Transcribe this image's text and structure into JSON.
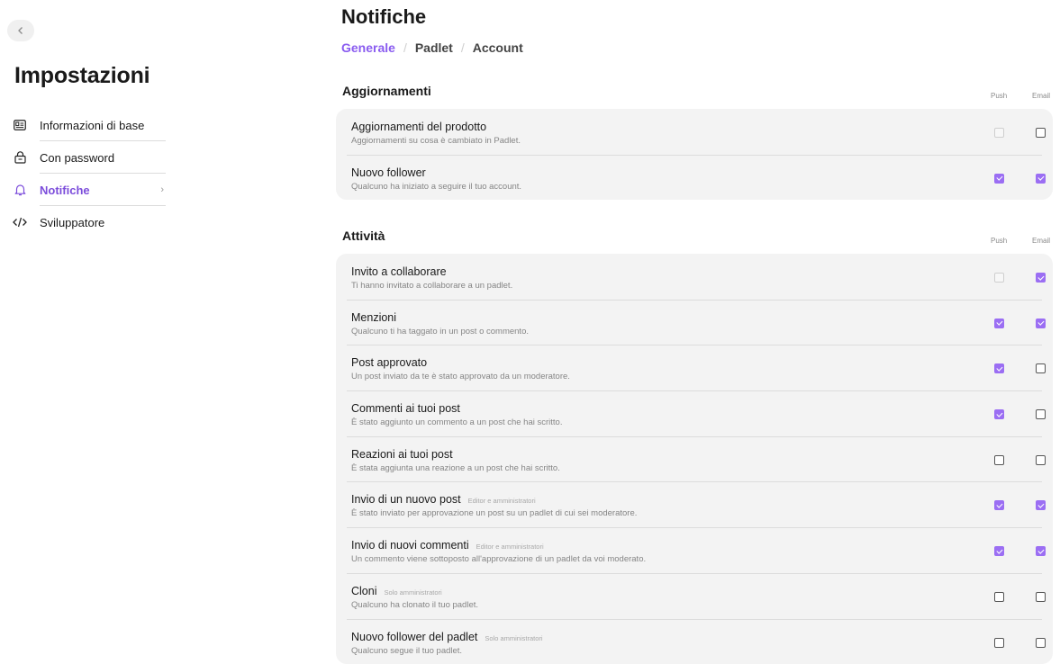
{
  "sidebar": {
    "title": "Impostazioni",
    "items": [
      {
        "label": "Informazioni di base",
        "icon": "id-card-icon"
      },
      {
        "label": "Con password",
        "icon": "lock-icon"
      },
      {
        "label": "Notifiche",
        "icon": "bell-icon",
        "active": true
      },
      {
        "label": "Sviluppatore",
        "icon": "code-icon"
      }
    ]
  },
  "page": {
    "title": "Notifiche",
    "tabs": [
      "Generale",
      "Padlet",
      "Account"
    ],
    "active_tab": "Generale",
    "separator": "/"
  },
  "columns": {
    "push": "Push",
    "email": "Email"
  },
  "sections": [
    {
      "title": "Aggiornamenti",
      "rows": [
        {
          "title": "Aggiornamenti del prodotto",
          "desc": "Aggiornamenti su cosa è cambiato in Padlet.",
          "tag": "",
          "push": "disabled",
          "email": "off"
        },
        {
          "title": "Nuovo follower",
          "desc": "Qualcuno ha iniziato a seguire il tuo account.",
          "tag": "",
          "push": "on",
          "email": "on"
        }
      ]
    },
    {
      "title": "Attività",
      "rows": [
        {
          "title": "Invito a collaborare",
          "desc": "Ti hanno invitato a collaborare a un padlet.",
          "tag": "",
          "push": "disabled",
          "email": "on"
        },
        {
          "title": "Menzioni",
          "desc": "Qualcuno ti ha taggato in un post o commento.",
          "tag": "",
          "push": "on",
          "email": "on"
        },
        {
          "title": "Post approvato",
          "desc": "Un post inviato da te è stato approvato da un moderatore.",
          "tag": "",
          "push": "on",
          "email": "off"
        },
        {
          "title": "Commenti ai tuoi post",
          "desc": "È stato aggiunto un commento a un post che hai scritto.",
          "tag": "",
          "push": "on",
          "email": "off"
        },
        {
          "title": "Reazioni ai tuoi post",
          "desc": "È stata aggiunta una reazione a un post che hai scritto.",
          "tag": "",
          "push": "off",
          "email": "off"
        },
        {
          "title": "Invio di un nuovo post",
          "desc": "È stato inviato per approvazione un post su un padlet di cui sei moderatore.",
          "tag": "Editor e amministratori",
          "push": "on",
          "email": "on"
        },
        {
          "title": "Invio di nuovi commenti",
          "desc": "Un commento viene sottoposto all'approvazione di un padlet da voi moderato.",
          "tag": "Editor e amministratori",
          "push": "on",
          "email": "on"
        },
        {
          "title": "Cloni",
          "desc": "Qualcuno ha clonato il tuo padlet.",
          "tag": "Solo amministratori",
          "push": "off",
          "email": "off"
        },
        {
          "title": "Nuovo follower del padlet",
          "desc": "Qualcuno segue il tuo padlet.",
          "tag": "Solo amministratori",
          "push": "off",
          "email": "off"
        }
      ]
    }
  ],
  "colors": {
    "accent": "#8a5cf0",
    "checkbox_on": "#9b6ef3"
  }
}
